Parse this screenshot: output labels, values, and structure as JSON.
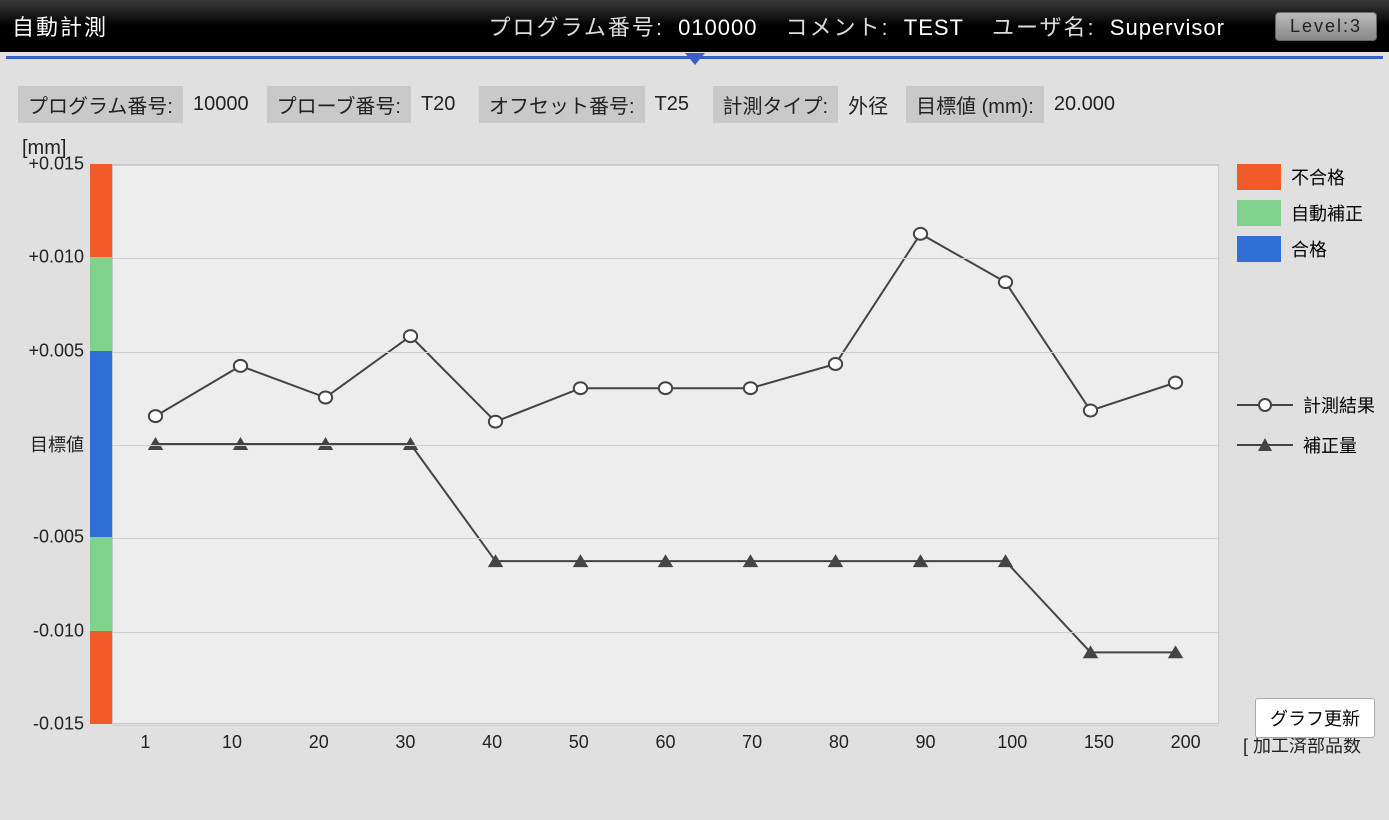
{
  "header": {
    "title": "自動計測",
    "program_label": "プログラム番号:",
    "program_value": "010000",
    "comment_label": "コメント:",
    "comment_value": "TEST",
    "user_label": "ユーザ名:",
    "user_value": "Supervisor",
    "level_label": "Level:3"
  },
  "params": {
    "program_no_label": "プログラム番号:",
    "program_no_value": "10000",
    "probe_no_label": "プローブ番号:",
    "probe_no_value": "T20",
    "offset_no_label": "オフセット番号:",
    "offset_no_value": "T25",
    "measure_type_label": "計測タイプ:",
    "measure_type_value": "外径",
    "target_label": "目標値 (mm):",
    "target_value": "20.000"
  },
  "unit": "[mm]",
  "y_ticks": [
    "+0.015",
    "+0.010",
    "+0.005",
    "目標値",
    "-0.005",
    "-0.010",
    "-0.015"
  ],
  "x_ticks": [
    "1",
    "10",
    "20",
    "30",
    "40",
    "50",
    "60",
    "70",
    "80",
    "90",
    "100",
    "150",
    "200"
  ],
  "x_axis_label": "[ 加工済部品数",
  "color_bands": [
    {
      "color": "#f15a29",
      "from": 0.01,
      "to": 0.015
    },
    {
      "color": "#7fd18c",
      "from": 0.005,
      "to": 0.01
    },
    {
      "color": "#2f6fd6",
      "from": -0.005,
      "to": 0.005
    },
    {
      "color": "#7fd18c",
      "from": -0.01,
      "to": -0.005
    },
    {
      "color": "#f15a29",
      "from": -0.015,
      "to": -0.01
    }
  ],
  "legend": {
    "fail": "不合格",
    "auto": "自動補正",
    "pass": "合格",
    "series_measure": "計測結果",
    "series_correction": "補正量"
  },
  "update_button": "グラフ更新",
  "chart_data": {
    "type": "line",
    "title": "",
    "xlabel": "加工済部品数",
    "ylabel": "mm",
    "ylim": [
      -0.015,
      0.015
    ],
    "categories": [
      "1",
      "10",
      "20",
      "30",
      "40",
      "50",
      "60",
      "70",
      "80",
      "90",
      "100",
      "150",
      "200"
    ],
    "series": [
      {
        "name": "計測結果",
        "marker": "circle",
        "values": [
          0.0015,
          0.0042,
          0.0025,
          0.0058,
          0.0012,
          0.003,
          0.003,
          0.003,
          0.0043,
          0.0113,
          0.0087,
          0.0018,
          0.0033
        ]
      },
      {
        "name": "補正量",
        "marker": "triangle",
        "values": [
          0.0,
          0.0,
          0.0,
          0.0,
          -0.0063,
          -0.0063,
          -0.0063,
          -0.0063,
          -0.0063,
          -0.0063,
          -0.0063,
          -0.0112,
          -0.0112
        ]
      }
    ]
  }
}
